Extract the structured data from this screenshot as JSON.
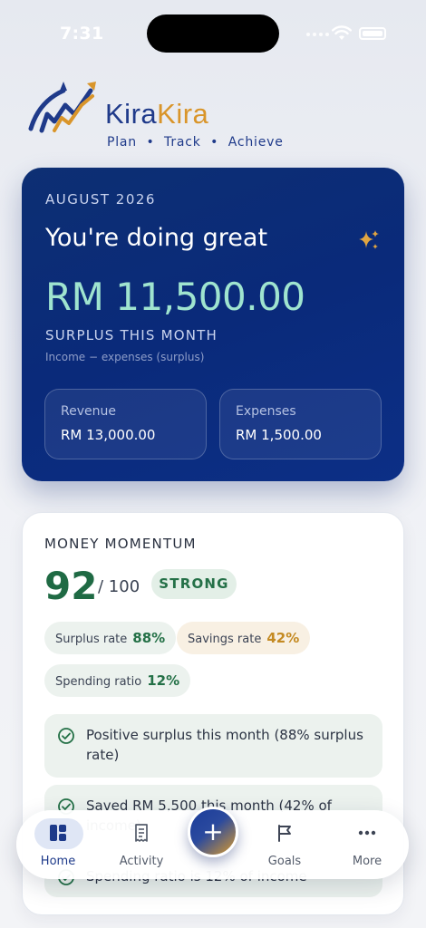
{
  "status_bar": {
    "time": "7:31"
  },
  "brand": {
    "name_part1": "Kira",
    "name_part2": "Kira",
    "tagline": "Plan  •  Track  •  Achieve"
  },
  "hero": {
    "month": "AUGUST 2026",
    "title": "You're doing great",
    "amount": "RM 11,500.00",
    "amount_label": "SURPLUS THIS MONTH",
    "note": "Income − expenses (surplus)",
    "revenue": {
      "label": "Revenue",
      "value": "RM 13,000.00"
    },
    "expenses": {
      "label": "Expenses",
      "value": "RM 1,500.00"
    }
  },
  "momentum": {
    "title": "MONEY MOMENTUM",
    "score": "92",
    "score_max": "/ 100",
    "badge": "STRONG",
    "pills": [
      {
        "label": "Surplus rate",
        "value": "88%"
      },
      {
        "label": "Savings rate",
        "value": "42%"
      },
      {
        "label": "Spending ratio",
        "value": "12%"
      }
    ],
    "checks": [
      "Positive surplus this month (88% surplus rate)",
      "Saved RM 5,500 this month (42% of income)",
      "Spending ratio is 12% of income"
    ]
  },
  "nav": {
    "items": [
      {
        "label": "Home",
        "icon": "home-grid-icon"
      },
      {
        "label": "Activity",
        "icon": "receipt-icon"
      },
      {
        "label": "Goals",
        "icon": "flag-icon"
      },
      {
        "label": "More",
        "icon": "more-dots-icon"
      }
    ],
    "fab_label": "+"
  },
  "colors": {
    "brand_blue": "#1f3a8a",
    "brand_gold": "#d9952a",
    "hero_bg": "#0a2a7a",
    "surplus_green": "#9fe4cf",
    "score_green": "#1f6a44"
  }
}
